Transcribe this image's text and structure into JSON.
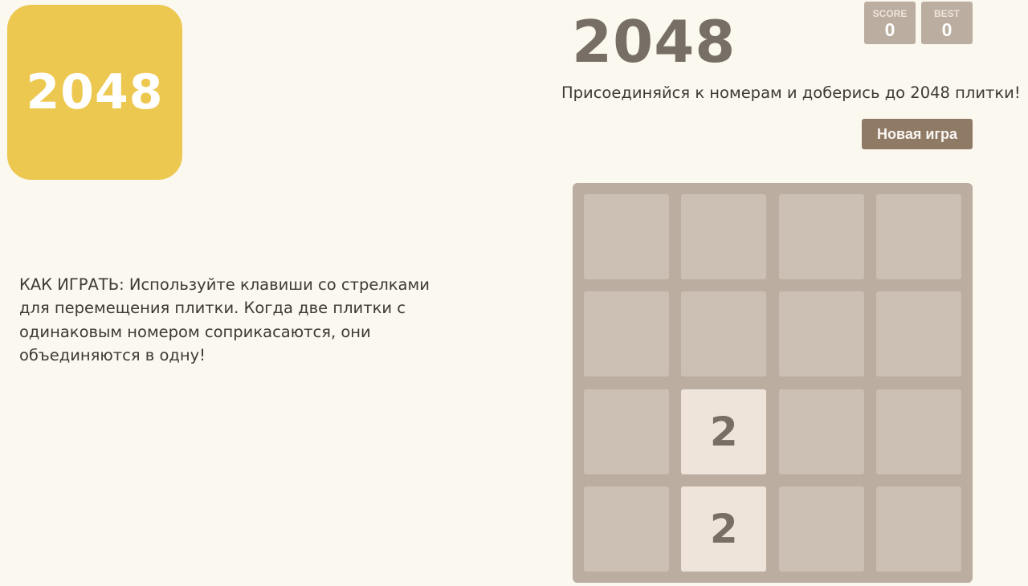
{
  "logo": {
    "text": "2048",
    "color": "#edc850"
  },
  "header": {
    "title": "2048",
    "intro": "Присоединяйся к номерам и доберись до 2048 плитки!"
  },
  "scores": {
    "score_label": "SCORE",
    "score_value": "0",
    "best_label": "BEST",
    "best_value": "0"
  },
  "controls": {
    "new_game_label": "Новая игра"
  },
  "instructions": "КАК ИГРАТЬ: Используйте клавиши со стрелками для перемещения плитки. Когда две плитки с одинаковым номером соприкасаются, они объединяются в одну!",
  "board": {
    "size": 4,
    "grid": [
      [
        null,
        null,
        null,
        null
      ],
      [
        null,
        null,
        null,
        null
      ],
      [
        null,
        2,
        null,
        null
      ],
      [
        null,
        2,
        null,
        null
      ]
    ]
  },
  "colors": {
    "background": "#faf8ef",
    "board": "#bbada0",
    "tile_2": "#eee4da",
    "text": "#776e65",
    "button": "#8f7a66"
  }
}
